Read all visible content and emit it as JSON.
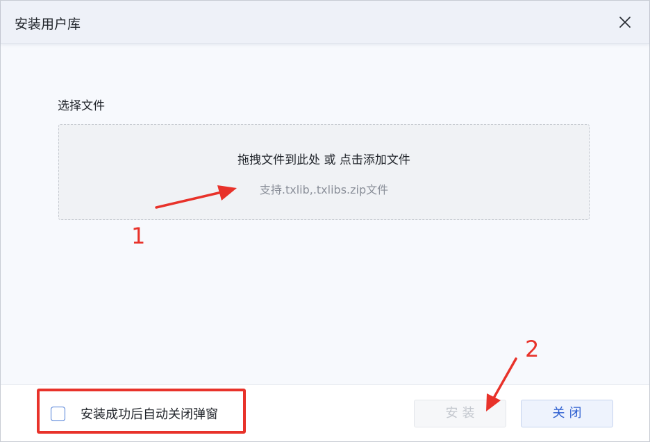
{
  "dialog": {
    "title": "安装用户库",
    "close_icon": "close-icon"
  },
  "upload": {
    "section_label": "选择文件",
    "main_text": "拖拽文件到此处 或 点击添加文件",
    "hint_text": "支持.txlib,.txlibs.zip文件"
  },
  "footer": {
    "auto_close_label": "安装成功后自动关闭弹窗",
    "auto_close_checked": false,
    "install_label": "安装",
    "install_disabled": true,
    "close_label": "关闭"
  },
  "annotations": {
    "marker_1": "1",
    "marker_2": "2",
    "color": "#e8322a"
  },
  "colors": {
    "accent": "#2d5fd0",
    "annotation": "#e8322a"
  }
}
